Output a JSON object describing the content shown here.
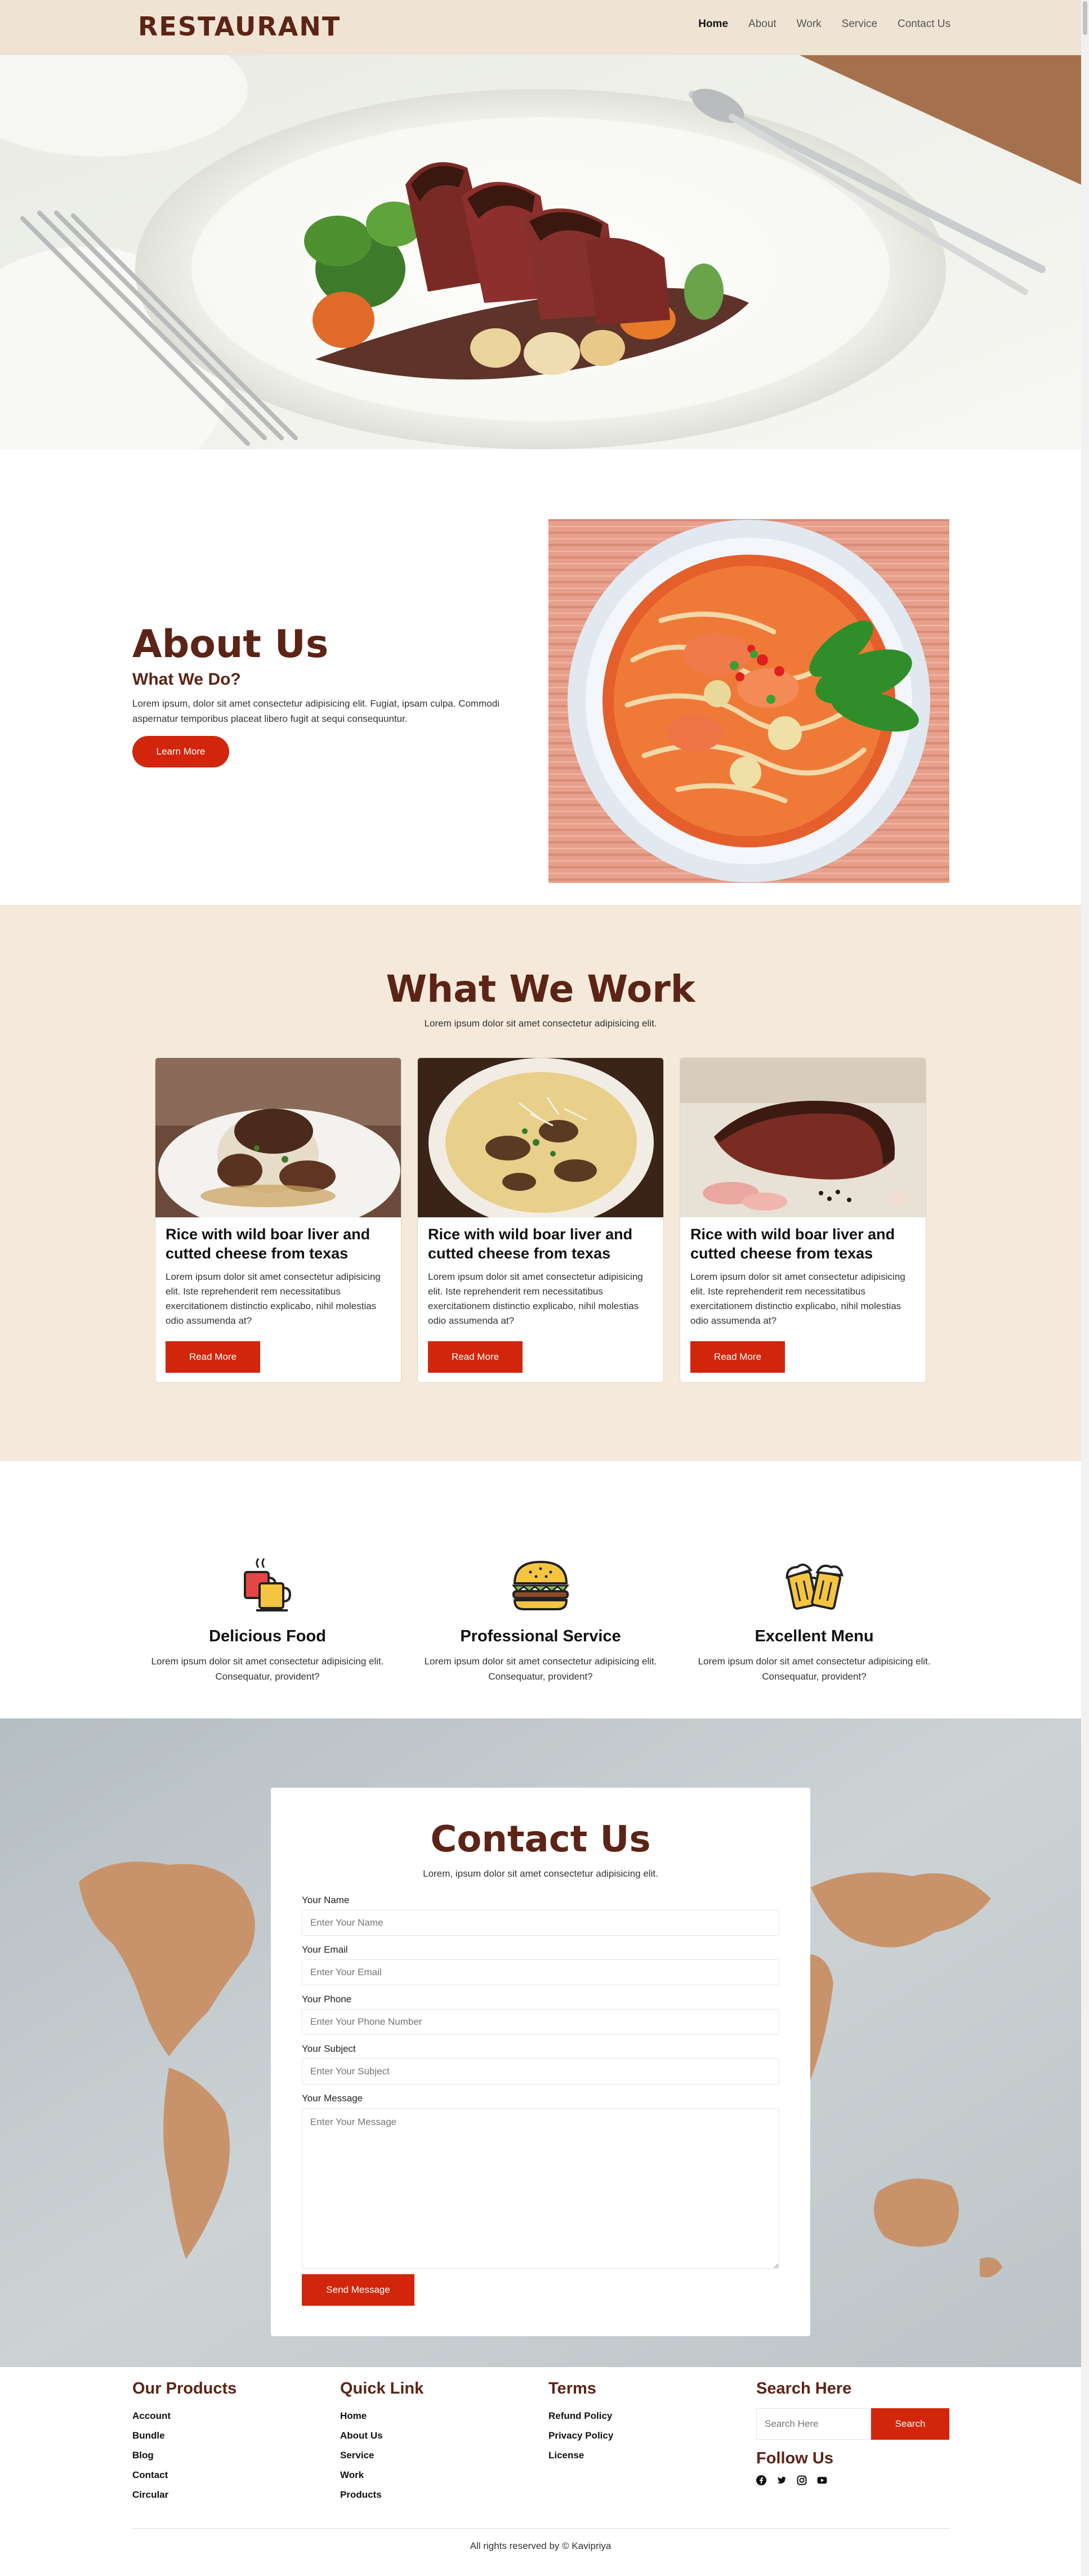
{
  "header": {
    "logo": "RESTAURANT",
    "nav": [
      "Home",
      "About",
      "Work",
      "Service",
      "Contact Us"
    ]
  },
  "about": {
    "title": "About Us",
    "subtitle": "What We Do?",
    "text": "Lorem ipsum, dolor sit amet consectetur adipisicing elit. Fugiat, ipsam culpa. Commodi aspernatur temporibus placeat libero fugit at sequi consequuntur.",
    "button": "Learn More"
  },
  "work": {
    "title": "What We Work",
    "subtitle": "Lorem ipsum dolor sit amet consectetur adipisicing elit.",
    "cards": [
      {
        "title": "Rice with wild boar liver and cutted cheese from texas",
        "text": "Lorem ipsum dolor sit amet consectetur adipisicing elit. Iste reprehenderit rem necessitatibus exercitationem distinctio explicabo, nihil molestias odio assumenda at?",
        "button": "Read More"
      },
      {
        "title": "Rice with wild boar liver and cutted cheese from texas",
        "text": "Lorem ipsum dolor sit amet consectetur adipisicing elit. Iste reprehenderit rem necessitatibus exercitationem distinctio explicabo, nihil molestias odio assumenda at?",
        "button": "Read More"
      },
      {
        "title": "Rice with wild boar liver and cutted cheese from texas",
        "text": "Lorem ipsum dolor sit amet consectetur adipisicing elit. Iste reprehenderit rem necessitatibus exercitationem distinctio explicabo, nihil molestias odio assumenda at?",
        "button": "Read More"
      }
    ]
  },
  "features": [
    {
      "icon": "coffee-cups-icon",
      "name": "Delicious Food",
      "text": "Lorem ipsum dolor sit amet consectetur adipisicing elit. Consequatur, provident?"
    },
    {
      "icon": "burger-icon",
      "name": "Professional Service",
      "text": "Lorem ipsum dolor sit amet consectetur adipisicing elit. Consequatur, provident?"
    },
    {
      "icon": "beer-mugs-icon",
      "name": "Excellent Menu",
      "text": "Lorem ipsum dolor sit amet consectetur adipisicing elit. Consequatur, provident?"
    }
  ],
  "contact": {
    "title": "Contact Us",
    "subtitle": "Lorem, ipsum dolor sit amet consectetur adipisicing elit.",
    "fields": [
      {
        "label": "Your Name",
        "placeholder": "Enter Your Name"
      },
      {
        "label": "Your Email",
        "placeholder": "Enter Your Email"
      },
      {
        "label": "Your Phone",
        "placeholder": "Enter Your Phone Number"
      },
      {
        "label": "Your Subject",
        "placeholder": "Enter Your Subject"
      }
    ],
    "message_label": "Your Message",
    "message_placeholder": "Enter Your Message",
    "button": "Send Message"
  },
  "footer": {
    "products": {
      "title": "Our Products",
      "links": [
        "Account",
        "Bundle",
        "Blog",
        "Contact",
        "Circular"
      ]
    },
    "quick": {
      "title": "Quick Link",
      "links": [
        "Home",
        "About Us",
        "Service",
        "Work",
        "Products"
      ]
    },
    "terms": {
      "title": "Terms",
      "links": [
        "Refund Policy",
        "Privacy Policy",
        "License"
      ]
    },
    "search": {
      "title": "Search Here",
      "placeholder": "Search Here",
      "button": "Search"
    },
    "follow": "Follow Us",
    "social_icons": [
      "facebook-icon",
      "twitter-icon",
      "instagram-icon",
      "youtube-icon"
    ],
    "copyright": "All rights reserved by © Kavipriya"
  },
  "colors": {
    "brand": "#5c2416",
    "accent": "#d1260b",
    "cream": "#f4e9da",
    "header": "#efe4d3"
  }
}
